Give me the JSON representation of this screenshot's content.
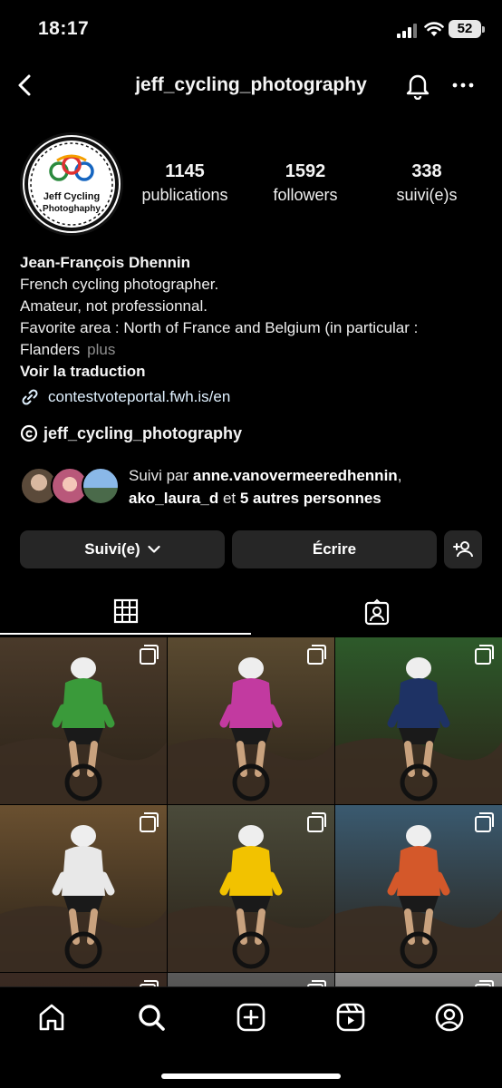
{
  "status_bar": {
    "time": "18:17",
    "battery": "52"
  },
  "top_nav": {
    "username": "jeff_cycling_photography"
  },
  "avatar": {
    "line1": "Jeff Cycling",
    "line2": "Photoghaphy"
  },
  "stats": [
    {
      "value": "1145",
      "label": "publications"
    },
    {
      "value": "1592",
      "label": "followers"
    },
    {
      "value": "338",
      "label": "suivi(e)s"
    }
  ],
  "bio": {
    "name": "Jean-François Dhennin",
    "lines": [
      "French cycling photographer.",
      "Amateur, not professionnal.",
      "Favorite area : North of France and Belgium (in particular :",
      "Flanders"
    ],
    "more": "plus",
    "translate": "Voir la traduction",
    "link": "contestvoteportal.fwh.is/en",
    "threads": "jeff_cycling_photography"
  },
  "followed_by": {
    "prefix": "Suivi par ",
    "user1": "anne.vanovermeeredhennin",
    "sep": ",",
    "user2": "ako_laura_d",
    "mid": " et ",
    "others": "5 autres personnes"
  },
  "buttons": {
    "follow": "Suivi(e)",
    "message": "Écrire"
  },
  "tabs": [
    "grid-icon",
    "tagged-icon"
  ],
  "grid_photos": [
    {
      "jersey": "#3a9a3a",
      "bg": "#4a3a2a"
    },
    {
      "jersey": "#c23aa0",
      "bg": "#5a4a30"
    },
    {
      "jersey": "#1e3264",
      "bg": "#2d5a2a"
    },
    {
      "jersey": "#e8e8e8",
      "bg": "#6a5030"
    },
    {
      "jersey": "#f2c200",
      "bg": "#4a4a3a"
    },
    {
      "jersey": "#d4582a",
      "bg": "#3a5a70"
    },
    {
      "jersey": "#7a2a8a",
      "bg": "#3a2a22"
    },
    {
      "jersey": "#222222",
      "bg": "#5a5a5a"
    },
    {
      "jersey": "#c43a2a",
      "bg": "#8a8a8a"
    }
  ],
  "bottom_nav": [
    "home-icon",
    "search-icon",
    "create-icon",
    "reels-icon",
    "profile-icon"
  ]
}
